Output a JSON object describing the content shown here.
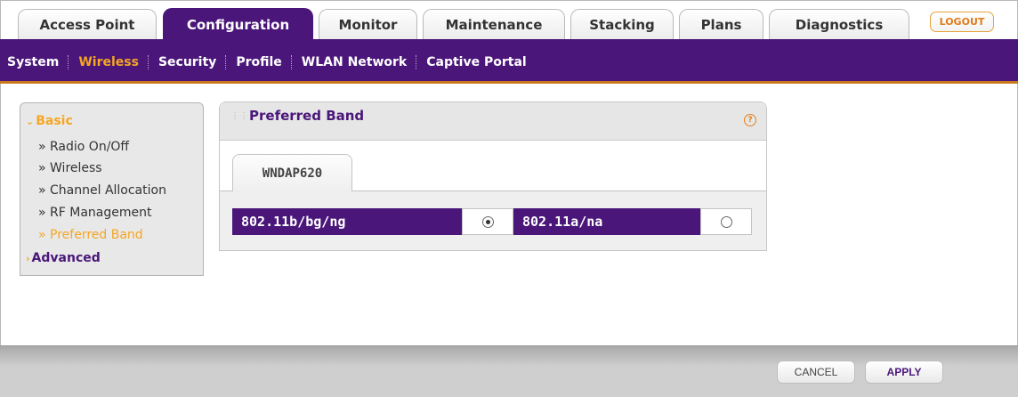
{
  "top_tabs": [
    {
      "label": "Access Point",
      "active": false
    },
    {
      "label": "Configuration",
      "active": true
    },
    {
      "label": "Monitor",
      "active": false
    },
    {
      "label": "Maintenance",
      "active": false
    },
    {
      "label": "Stacking",
      "active": false
    },
    {
      "label": "Plans",
      "active": false
    },
    {
      "label": "Diagnostics",
      "active": false
    }
  ],
  "logout_label": "LOGOUT",
  "sub_nav": [
    {
      "label": "System",
      "current": false
    },
    {
      "label": "Wireless",
      "current": true
    },
    {
      "label": "Security",
      "current": false
    },
    {
      "label": "Profile",
      "current": false
    },
    {
      "label": "WLAN Network",
      "current": false
    },
    {
      "label": "Captive Portal",
      "current": false
    }
  ],
  "left_menu": {
    "basic_label": "Basic",
    "items": [
      {
        "label": "» Radio On/Off",
        "current": false
      },
      {
        "label": "» Wireless",
        "current": false
      },
      {
        "label": "» Channel Allocation",
        "current": false
      },
      {
        "label": "» RF Management",
        "current": false
      },
      {
        "label": "» Preferred Band",
        "current": true
      }
    ],
    "advanced_label": "Advanced"
  },
  "panel": {
    "title": "Preferred Band",
    "help_icon": "question-circle-icon",
    "sub_tab": "WNDAP620",
    "bands": [
      {
        "label": "802.11b/bg/ng",
        "selected": true
      },
      {
        "label": "802.11a/na",
        "selected": false
      }
    ]
  },
  "buttons": {
    "cancel": "CANCEL",
    "apply": "APPLY"
  },
  "colors": {
    "brand_purple": "#4a167a",
    "accent_orange": "#f5a623"
  }
}
